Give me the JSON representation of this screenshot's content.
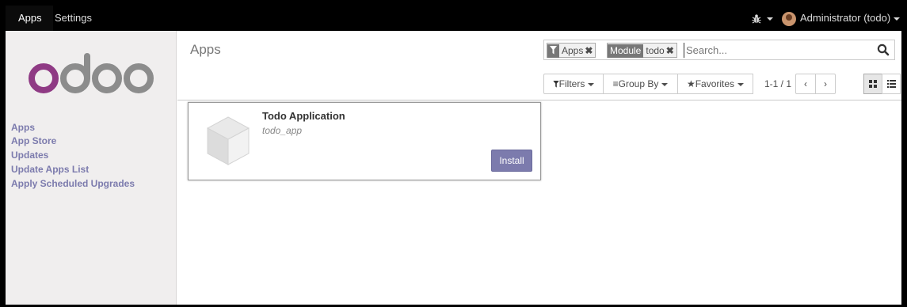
{
  "topbar": {
    "menus": [
      "Apps",
      "Settings"
    ],
    "user_label": "Administrator (todo)"
  },
  "logo_text": "odoo",
  "sidebar": {
    "items": [
      {
        "label": "Apps"
      },
      {
        "label": "App Store"
      },
      {
        "label": "Updates"
      },
      {
        "label": "Update Apps List"
      },
      {
        "label": "Apply Scheduled Upgrades"
      }
    ]
  },
  "control_panel": {
    "breadcrumb": "Apps",
    "search": {
      "facets": [
        {
          "tag": "",
          "value": "Apps"
        },
        {
          "tag": "Module",
          "value": "todo"
        }
      ],
      "placeholder": "Search..."
    },
    "filters_label": "Filters",
    "groupby_label": "Group By",
    "favorites_label": "Favorites",
    "pager": "1-1 / 1"
  },
  "kanban": {
    "records": [
      {
        "title": "Todo Application",
        "technical_name": "todo_app",
        "button_label": "Install"
      }
    ]
  },
  "colors": {
    "brand": "#7c7bad",
    "topbar": "#000000",
    "sidebar": "#f0eeee",
    "logo": "#8f3a84"
  },
  "icons": [
    "bug-icon",
    "filter-icon",
    "close-icon",
    "search-icon",
    "list-icon",
    "star-icon",
    "chevron-left-icon",
    "chevron-right-icon",
    "kanban-view-icon",
    "list-view-icon",
    "module-icon"
  ]
}
